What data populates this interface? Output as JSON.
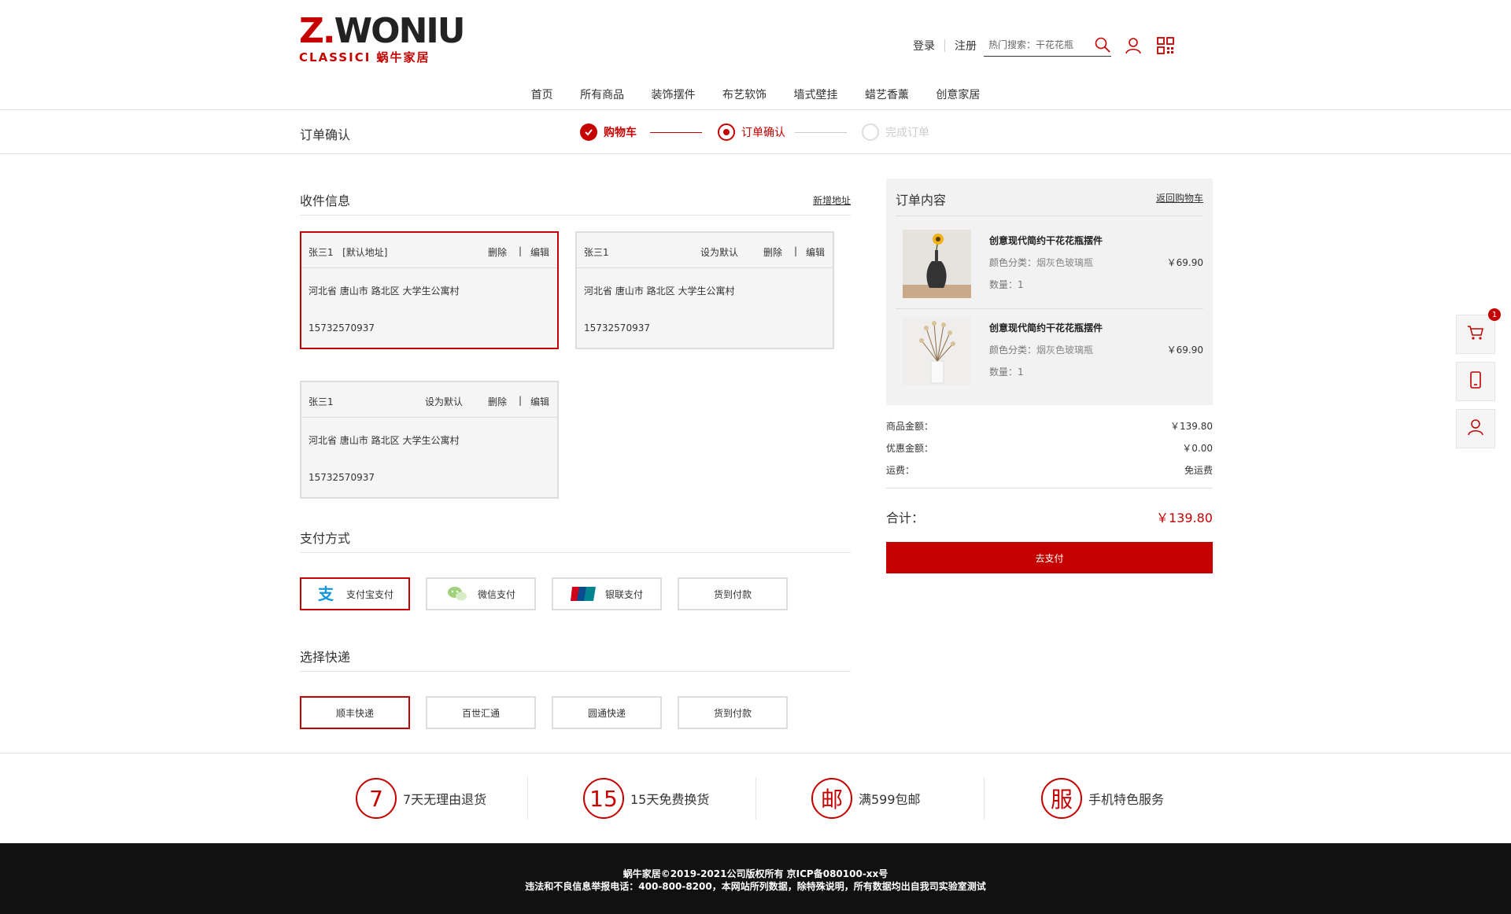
{
  "brand": {
    "main_z": "Z.",
    "main_rest": "WONIU",
    "sub": "CLASSICI 蜗牛家居"
  },
  "top_links": {
    "login": "登录",
    "register": "注册"
  },
  "search": {
    "placeholder": "热门搜索：干花花瓶"
  },
  "nav": [
    "首页",
    "所有商品",
    "装饰摆件",
    "布艺软饰",
    "墙式壁挂",
    "蜡艺香薰",
    "创意家居"
  ],
  "page_title": "订单确认",
  "steps": [
    {
      "label": "购物车",
      "state": "done"
    },
    {
      "label": "订单确认",
      "state": "current"
    },
    {
      "label": "完成订单",
      "state": "pending"
    }
  ],
  "shipping_info": {
    "title": "收件信息",
    "add_label": "新增地址",
    "addresses": [
      {
        "name": "张三1",
        "tag": "[默认地址]",
        "delete": "删除",
        "divider": "|",
        "edit": "编辑",
        "address": "河北省 唐山市 路北区 大学生公寓村",
        "phone": "15732570937",
        "selected": true
      },
      {
        "name": "张三1",
        "set_default": "设为默认",
        "delete": "删除",
        "divider": "|",
        "edit": "编辑",
        "address": "河北省 唐山市 路北区 大学生公寓村",
        "phone": "15732570937",
        "selected": false
      },
      {
        "name": "张三1",
        "set_default": "设为默认",
        "delete": "删除",
        "divider": "|",
        "edit": "编辑",
        "address": "河北省 唐山市 路北区 大学生公寓村",
        "phone": "15732570937",
        "selected": false
      }
    ]
  },
  "payment": {
    "title": "支付方式",
    "options": [
      {
        "label": "支付宝支付",
        "icon": "alipay-icon",
        "selected": true
      },
      {
        "label": "微信支付",
        "icon": "wechat-icon",
        "selected": false
      },
      {
        "label": "银联支付",
        "icon": "unionpay-icon",
        "selected": false
      },
      {
        "label": "货到付款",
        "icon": "",
        "selected": false
      }
    ]
  },
  "express": {
    "title": "选择快递",
    "options": [
      {
        "label": "顺丰快递",
        "selected": true
      },
      {
        "label": "百世汇通",
        "selected": false
      },
      {
        "label": "圆通快递",
        "selected": false
      },
      {
        "label": "货到付款",
        "selected": false
      }
    ]
  },
  "order": {
    "title": "订单内容",
    "back_label": "返回购物车",
    "items": [
      {
        "name": "创意现代简约干花花瓶摆件",
        "color_label": "颜色分类：",
        "color_value": "烟灰色玻璃瓶",
        "qty_label": "数量：",
        "qty": "1",
        "price": "￥69.90"
      },
      {
        "name": "创意现代简约干花花瓶摆件",
        "color_label": "颜色分类：",
        "color_value": "烟灰色玻璃瓶",
        "qty_label": "数量：",
        "qty": "1",
        "price": "￥69.90"
      }
    ],
    "summary": [
      {
        "label": "商品金额：",
        "value": "￥139.80"
      },
      {
        "label": "优惠金额：",
        "value": "￥0.00"
      },
      {
        "label": "运费：",
        "value": "免运费"
      }
    ],
    "total_label": "合计：",
    "total_value": "￥139.80",
    "pay_label": "去支付"
  },
  "float_bar": {
    "cart_count": "1"
  },
  "services": [
    {
      "mark": "7",
      "text": "7天无理由退货"
    },
    {
      "mark": "15",
      "text": "15天免费换货"
    },
    {
      "mark": "邮",
      "text": "满599包邮"
    },
    {
      "mark": "服",
      "text": "手机特色服务"
    }
  ],
  "footer": {
    "line1": "蜗牛家居©2019-2021公司版权所有 京ICP备080100-xx号",
    "line2": "违法和不良信息举报电话：400-800-8200，本网站所列数据，除特殊说明，所有数据均出自我司实验室测试"
  },
  "colors": {
    "accent": "#c40000",
    "panel": "#f2f2f2",
    "footer_bg": "#111111"
  }
}
